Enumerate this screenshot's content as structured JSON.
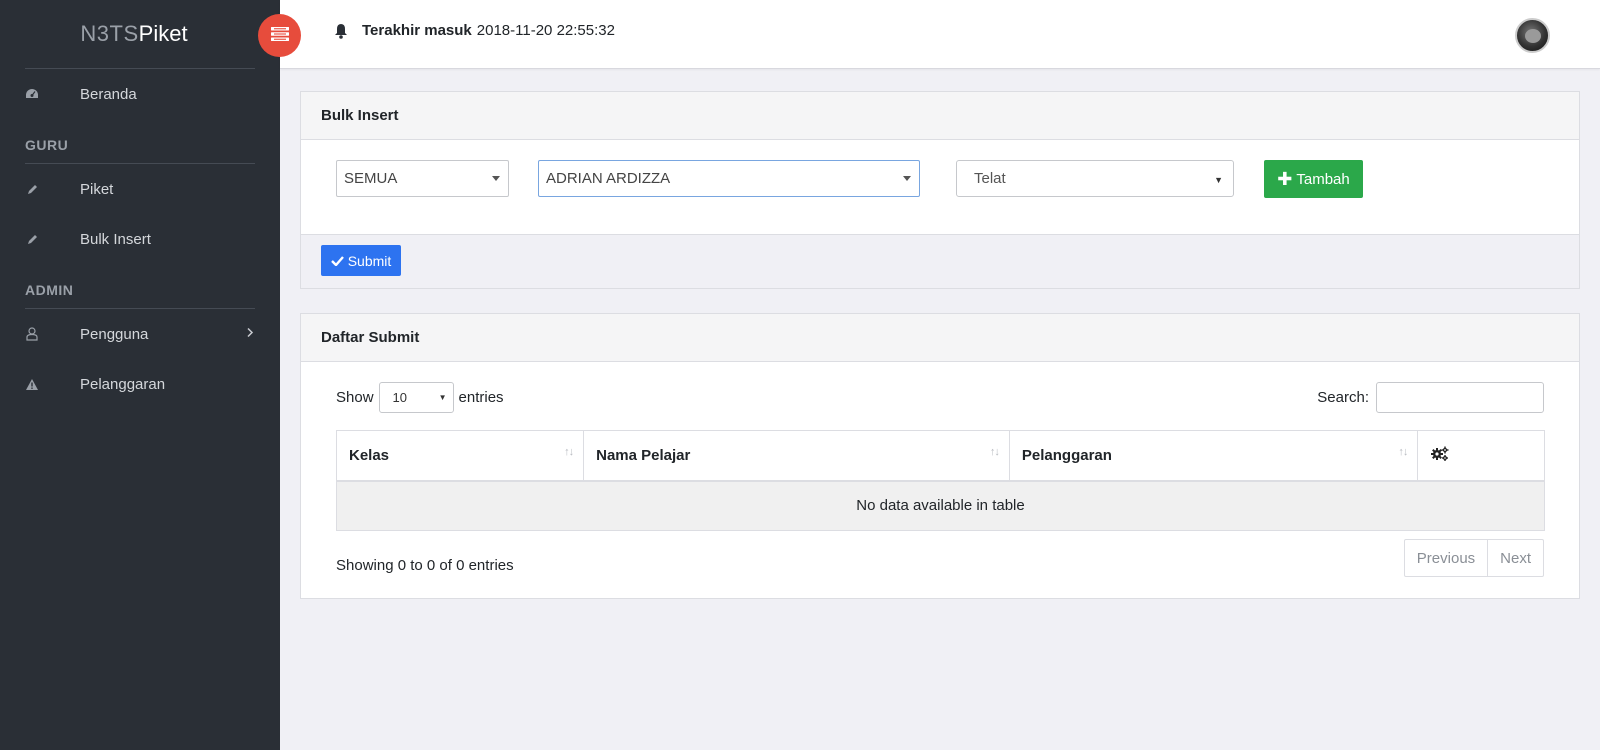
{
  "brand": {
    "thin": "N3TS",
    "bold": "Piket"
  },
  "sidebar": {
    "items_top": [
      {
        "label": "Beranda",
        "icon": "dashboard-icon"
      }
    ],
    "section_guru": "GURU",
    "items_guru": [
      {
        "label": "Piket",
        "icon": "pencil-icon"
      },
      {
        "label": "Bulk Insert",
        "icon": "pencil-icon"
      }
    ],
    "section_admin": "ADMIN",
    "items_admin": [
      {
        "label": "Pengguna",
        "icon": "user-icon"
      },
      {
        "label": "Pelanggaran",
        "icon": "warning-icon"
      }
    ]
  },
  "topbar": {
    "login_label": "Terakhir masuk",
    "login_time": "2018-11-20 22:55:32"
  },
  "bulk_insert": {
    "title": "Bulk Insert",
    "kelas_value": "SEMUA",
    "pelajar_value": "ADRIAN ARDIZZA",
    "pelanggaran_value": "Telat",
    "add_label": "Tambah",
    "submit_label": "Submit"
  },
  "daftar": {
    "title": "Daftar Submit",
    "show_label": "Show",
    "length_value": "10",
    "entries_label": "entries",
    "search_label": "Search:",
    "columns": [
      "Kelas",
      "Nama Pelajar",
      "Pelanggaran"
    ],
    "empty_text": "No data available in table",
    "info": "Showing 0 to 0 of 0 entries",
    "prev_label": "Previous",
    "next_label": "Next"
  },
  "colors": {
    "sidebar": "#2a2f36",
    "toggle": "#e74c3c",
    "add": "#2ba84a",
    "submit": "#2d73f0"
  }
}
